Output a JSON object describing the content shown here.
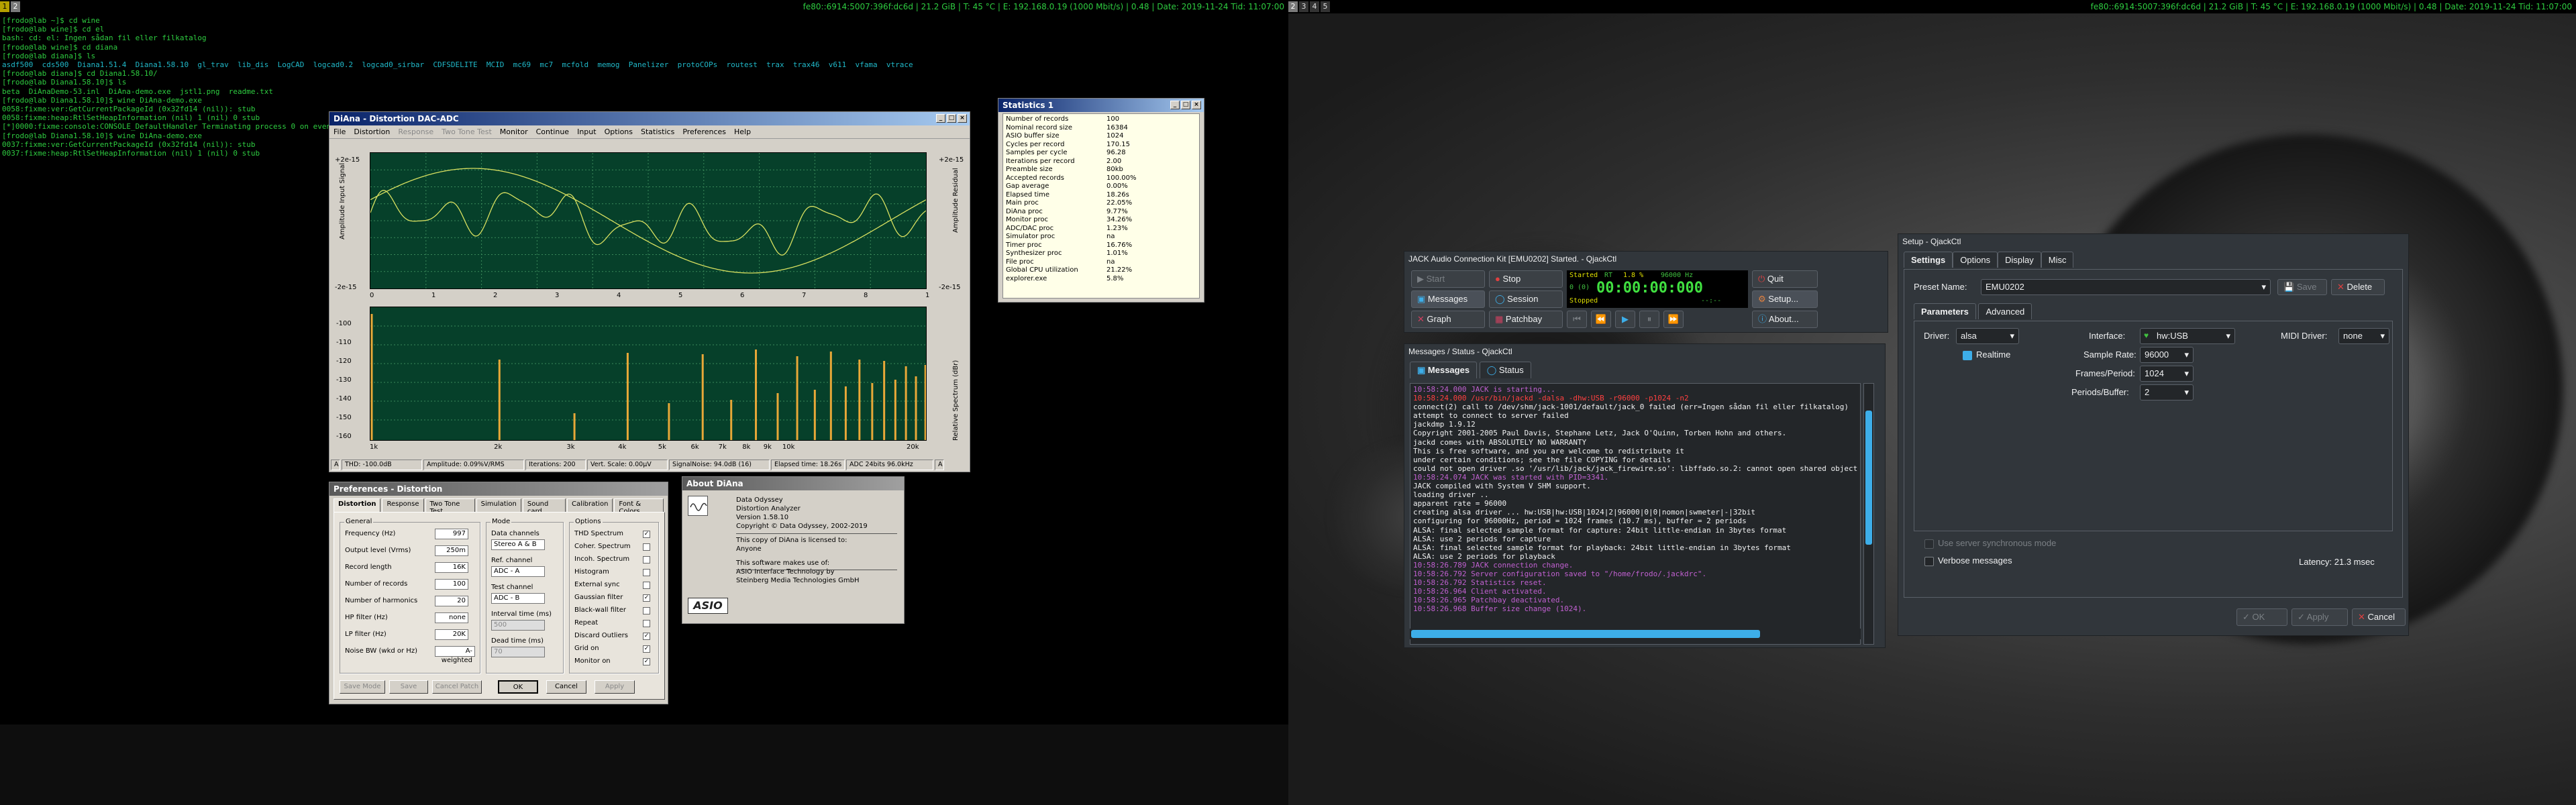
{
  "taskbar_left": {
    "workspaces": [
      "1",
      "2"
    ],
    "status": "fe80::6914:5007:396f:dc6d | 21.2 GiB | T: 45 °C | E: 192.168.0.19 (1000 Mbit/s) | 0.48 | Date: 2019-11-24  Tid: 11:07:00"
  },
  "taskbar_right": {
    "workspaces": [
      "2",
      "3",
      "4",
      "5"
    ],
    "status": "fe80::6914:5007:396f:dc6d | 21.2 GiB | T: 45 °C | E: 192.168.0.19 (1000 Mbit/s) | 0.48 | Date: 2019-11-24  Tid: 11:07:00"
  },
  "terminal": {
    "lines": [
      "[frodo@lab ~]$ cd wine",
      "[frodo@lab wine]$ cd el",
      "bash: cd: el: Ingen sådan fil eller filkatalog",
      "[frodo@lab wine]$ cd diana",
      "[frodo@lab diana]$ ls",
      "asdf500  cds500  Diana1.51.4  Diana1.58.10  gl_trav  lib_dis  LogCAD  logcad0.2  logcad0_sirbar  CDFSDELITE  MCID  mc69  mc7  mcfold  memog  Panelizer  protoCOPs  routest  trax  trax46  v611  vfama  vtrace",
      "[frodo@lab diana]$ cd Diana1.58.10/",
      "[frodo@lab Diana1.58.10]$ ls",
      "beta  DiAnaDemo-53.inl  DiAna-demo.exe  jstl1.png  readme.txt",
      "[frodo@lab Diana1.58.10]$ wine DiAna-demo.exe",
      "0058:fixme:ver:GetCurrentPackageId (0x32fd14 (nil)): stub",
      "0058:fixme:heap:RtlSetHeapInformation (nil) 1 (nil) 0 stub",
      "[*]0000:fixme:console:CONSOLE_DefaultHandler Terminating process 0 on event 0",
      "[frodo@lab Diana1.58.10]$ wine DiAna-demo.exe",
      "0037:fixme:ver:GetCurrentPackageId (0x32fd14 (nil)): stub",
      "0037:fixme:heap:RtlSetHeapInformation (nil) 1 (nil) 0 stub"
    ]
  },
  "diana": {
    "title": "DiAna - Distortion DAC-ADC",
    "menu": [
      "File",
      "Distortion",
      "Response",
      "Two Tone Test",
      "Monitor",
      "Continue",
      "Input",
      "Options",
      "Statistics",
      "Preferences",
      "Help"
    ],
    "upper_plot": {
      "left_label": "Amplitude Input Signal",
      "right_label": "Amplitude Residual",
      "left_top": "+2e-15",
      "left_bottom": "-2e-15",
      "right_top": "+2e-15",
      "right_bottom": "-2e-15",
      "x_ticks": [
        "0",
        "1",
        "2",
        "3",
        "4",
        "5",
        "6",
        "7",
        "8",
        "1"
      ]
    },
    "lower_plot": {
      "right_label": "Relative Spectrum (dBr)",
      "y_ticks": [
        "-100",
        "-110",
        "-120",
        "-130",
        "-140",
        "-150",
        "-160"
      ],
      "x_ticks": [
        "1k",
        "2k",
        "3k",
        "4k",
        "5k",
        "6k",
        "7k",
        "8k",
        "9k",
        "10k",
        "20k"
      ]
    },
    "status": [
      "A",
      "THD: -100.0dB",
      "Amplitude: 0.09%V/RMS",
      "Iterations: 200",
      "Vert. Scale: 0.00µV",
      "SignalNoise: 94.0dB (16)",
      "Elapsed time: 18.26s",
      "ADC 24bits 96.0kHz",
      "A"
    ]
  },
  "stats": {
    "title": "Statistics 1",
    "rows": [
      [
        "Number of records",
        "100"
      ],
      [
        "Nominal record size",
        "16384"
      ],
      [
        "ASIO buffer size",
        "1024"
      ],
      [
        "Cycles per record",
        "170.15"
      ],
      [
        "Samples per cycle",
        "96.28"
      ],
      [
        "Iterations per record",
        "2.00"
      ],
      [
        "Preamble size",
        "80kb"
      ],
      [
        "Accepted records",
        "100.00%"
      ],
      [
        "Gap average",
        "0.00%"
      ],
      [
        "Elapsed time",
        "18.26s"
      ],
      [
        "Main proc",
        "22.05%"
      ],
      [
        "DiAna proc",
        "9.77%"
      ],
      [
        "Monitor proc",
        "34.26%"
      ],
      [
        "ADC/DAC proc",
        "1.23%"
      ],
      [
        "Simulator proc",
        "na"
      ],
      [
        "Timer proc",
        "16.76%"
      ],
      [
        "Synthesizer proc",
        "1.01%"
      ],
      [
        "File proc",
        "na"
      ],
      [
        "Global CPU utilization",
        "21.22%"
      ],
      [
        "explorer.exe",
        "5.8%"
      ]
    ]
  },
  "prefs": {
    "title": "Preferences - Distortion",
    "tabs": [
      "Distortion",
      "Response",
      "Two Tone Test",
      "Simulation",
      "Sound card",
      "Calibration",
      "Font & Colors"
    ],
    "general_title": "General",
    "general": [
      [
        "Frequency (Hz)",
        "997"
      ],
      [
        "Output level (Vrms)",
        "250m"
      ],
      [
        "Record length",
        "16K"
      ],
      [
        "Number of records",
        "100"
      ],
      [
        "Number of harmonics",
        "20"
      ],
      [
        "HP filter (Hz)",
        "none"
      ],
      [
        "LP filter (Hz)",
        "20K"
      ],
      [
        "Noise BW (wkd or Hz)",
        "A-weighted"
      ]
    ],
    "mode_title": "Mode",
    "mode": [
      [
        "Data channels",
        "Stereo A & B"
      ],
      [
        "Ref. channel",
        "ADC - A"
      ],
      [
        "Test channel",
        "ADC - B"
      ],
      [
        "Interval time (ms)",
        "500"
      ],
      [
        "Dead time (ms)",
        "70"
      ]
    ],
    "options_title": "Options",
    "options": [
      [
        "THD Spectrum",
        true
      ],
      [
        "Coher. Spectrum",
        false
      ],
      [
        "Incoh. Spectrum",
        false
      ],
      [
        "Histogram",
        false
      ],
      [
        "External sync",
        false
      ],
      [
        "Gaussian filter",
        true
      ],
      [
        "Black-wall filter",
        false
      ],
      [
        "Repeat",
        false
      ],
      [
        "Discard Outliers",
        true
      ],
      [
        "Grid on",
        true
      ],
      [
        "Monitor on",
        true
      ]
    ],
    "buttons": {
      "save_mode": "Save Mode",
      "save": "Save",
      "cancel_patch": "Cancel Patch",
      "ok": "OK",
      "cancel": "Cancel",
      "apply": "Apply"
    }
  },
  "about": {
    "title": "About DiAna",
    "lines": [
      "Data Odyssey",
      "Distortion Analyzer",
      "Version 1.58.10",
      "Copyright © Data Odyssey, 2002-2019",
      "",
      "This copy of DiAna is licensed to:",
      "Anyone",
      "",
      "This software makes use of:",
      "ASIO Interface Technology by",
      "Steinberg Media Technologies GmbH"
    ],
    "asio": "ASIO"
  },
  "jack": {
    "title": "JACK Audio Connection Kit [EMU0202] Started. - QjackCtl",
    "buttons": {
      "start": "Start",
      "stop": "Stop",
      "quit": "Quit",
      "messages": "Messages",
      "session": "Session",
      "setup": "Setup...",
      "graph": "Graph",
      "patchbay": "Patchbay",
      "about": "About..."
    },
    "lcd": {
      "state": "Started",
      "rt": "RT",
      "dsp": "1.8 %",
      "rate": "96000 Hz",
      "xruns": "0 (0)",
      "time": "00:00:00:000",
      "stopped": "Stopped",
      "dots": "--:--"
    }
  },
  "messages": {
    "title": "Messages / Status - QjackCtl",
    "tabs": [
      "Messages",
      "Status"
    ],
    "lines": [
      [
        "p",
        "10:58:24.000 JACK is starting..."
      ],
      [
        "r",
        "10:58:24.000 /usr/bin/jackd -dalsa -dhw:USB -r96000 -p1024 -n2"
      ],
      [
        "",
        "connect(2) call to /dev/shm/jack-1001/default/jack_0 failed (err=Ingen sådan fil eller filkatalog)"
      ],
      [
        "",
        "attempt to connect to server failed"
      ],
      [
        "",
        "jackdmp 1.9.12"
      ],
      [
        "",
        "Copyright 2001-2005 Paul Davis, Stephane Letz, Jack O'Quinn, Torben Hohn and others."
      ],
      [
        "",
        "jackd comes with ABSOLUTELY NO WARRANTY"
      ],
      [
        "",
        "This is free software, and you are welcome to redistribute it"
      ],
      [
        "",
        "under certain conditions; see the file COPYING for details"
      ],
      [
        "",
        "could not open driver .so '/usr/lib/jack/jack_firewire.so': libffado.so.2: cannot open shared object file"
      ],
      [
        "p",
        "10:58:24.074 JACK was started with PID=3341."
      ],
      [
        "",
        "JACK compiled with System V SHM support."
      ],
      [
        "",
        "loading driver .."
      ],
      [
        "",
        "apparent rate = 96000"
      ],
      [
        "",
        "creating alsa driver ... hw:USB|hw:USB|1024|2|96000|0|0|nomon|swmeter|-|32bit"
      ],
      [
        "",
        "configuring for 96000Hz, period = 1024 frames (10.7 ms), buffer = 2 periods"
      ],
      [
        "",
        "ALSA: final selected sample format for capture: 24bit little-endian in 3bytes format"
      ],
      [
        "",
        "ALSA: use 2 periods for capture"
      ],
      [
        "",
        "ALSA: final selected sample format for playback: 24bit little-endian in 3bytes format"
      ],
      [
        "",
        "ALSA: use 2 periods for playback"
      ],
      [
        "p",
        "10:58:26.789 JACK connection change."
      ],
      [
        "p",
        "10:58:26.792 Server configuration saved to \"/home/frodo/.jackdrc\"."
      ],
      [
        "p",
        "10:58:26.792 Statistics reset."
      ],
      [
        "p",
        "10:58:26.964 Client activated."
      ],
      [
        "p",
        "10:58:26.965 Patchbay deactivated."
      ],
      [
        "p",
        "10:58:26.968 Buffer size change (1024)."
      ]
    ]
  },
  "setup": {
    "title": "Setup - QjackCtl",
    "tabs": [
      "Settings",
      "Options",
      "Display",
      "Misc"
    ],
    "preset_label": "Preset Name:",
    "preset": "EMU0202",
    "save": "Save",
    "delete": "Delete",
    "subtabs": [
      "Parameters",
      "Advanced"
    ],
    "driver_label": "Driver:",
    "driver": "alsa",
    "interface_label": "Interface:",
    "interface": "hw:USB",
    "midi_label": "MIDI Driver:",
    "midi": "none",
    "realtime": "Realtime",
    "sample_rate_label": "Sample Rate:",
    "sample_rate": "96000",
    "frames_label": "Frames/Period:",
    "frames": "1024",
    "periods_label": "Periods/Buffer:",
    "periods": "2",
    "sync_mode": "Use server synchronous mode",
    "verbose": "Verbose messages",
    "latency": "Latency: 21.3 msec",
    "ok": "OK",
    "apply": "Apply",
    "cancel": "Cancel"
  }
}
